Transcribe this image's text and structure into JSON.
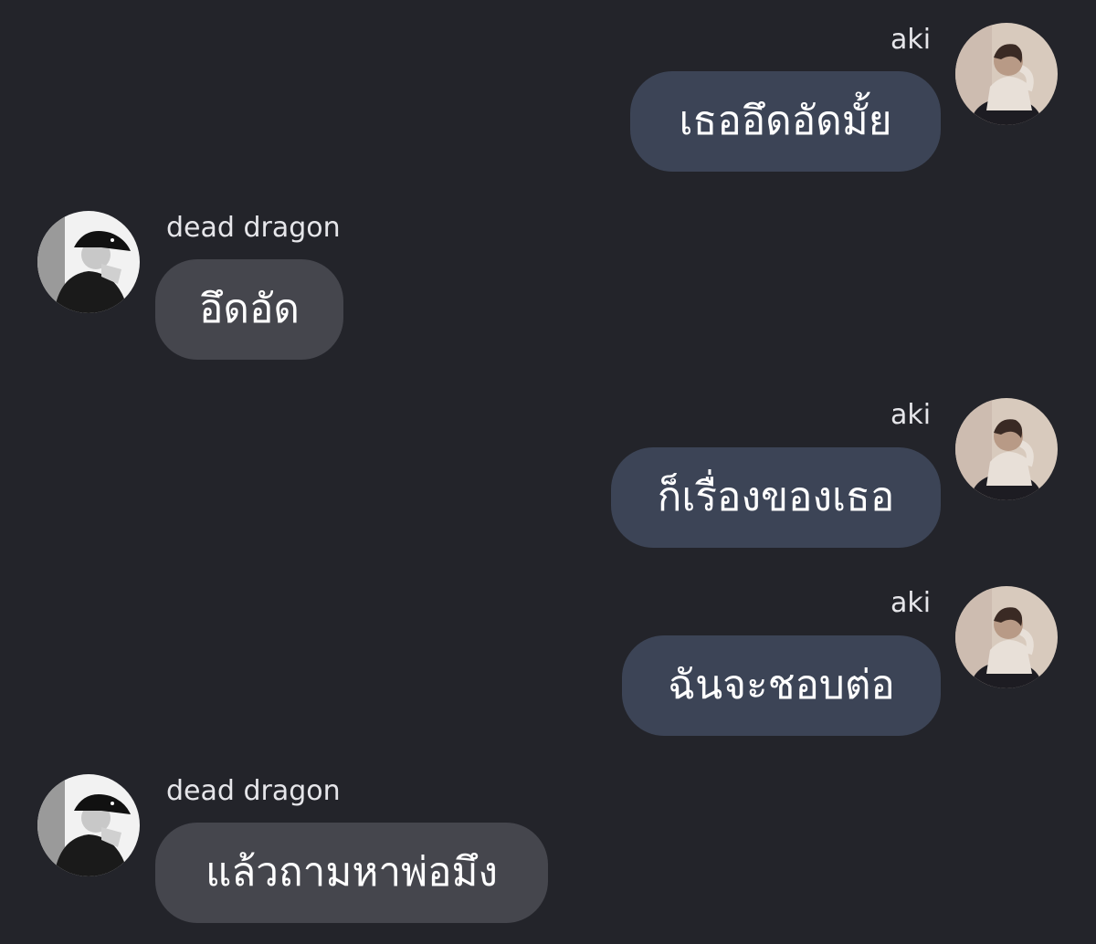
{
  "messages": [
    {
      "sender": "aki",
      "side": "right",
      "text": "เธออึดอัดมั้ย"
    },
    {
      "sender": "dead dragon",
      "side": "left",
      "text": "อึดอัด"
    },
    {
      "sender": "aki",
      "side": "right",
      "text": "ก็เรื่องของเธอ"
    },
    {
      "sender": "aki",
      "side": "right",
      "text": "ฉันจะชอบต่อ"
    },
    {
      "sender": "dead dragon",
      "side": "left",
      "text": "แล้วถามหาพ่อมึง"
    }
  ],
  "colors": {
    "background": "#23242a",
    "outgoing_bubble": "#3c4456",
    "incoming_bubble": "#45464d",
    "text": "#ffffff"
  },
  "avatars": {
    "aki": "person-photo-avatar",
    "dead dragon": "person-with-cap-photo-avatar"
  }
}
